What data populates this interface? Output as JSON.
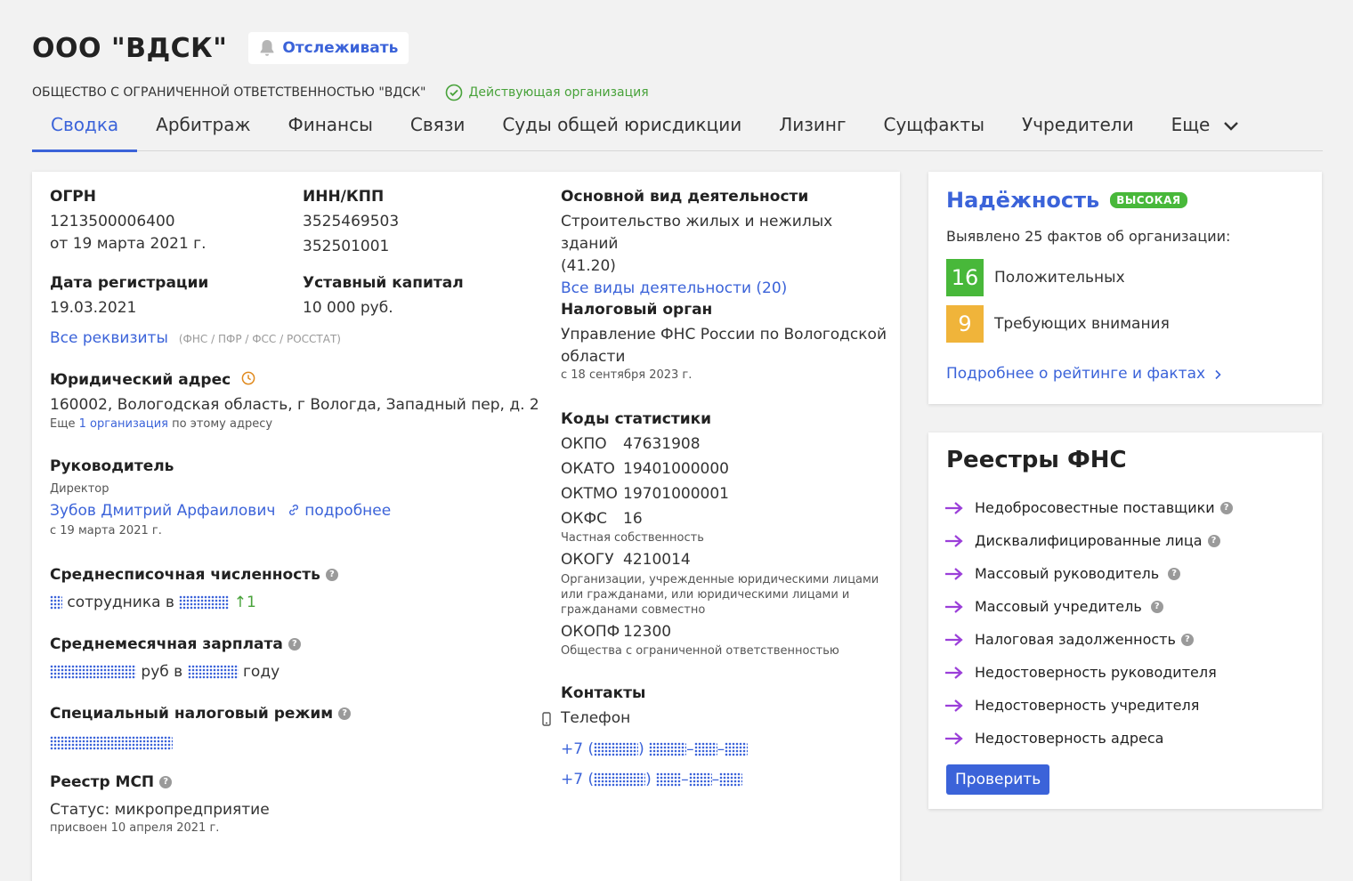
{
  "header": {
    "company_title": "ООО \"ВДСК\"",
    "follow_label": "Отслеживать",
    "full_name": "ОБЩЕСТВО С ОГРАНИЧЕННОЙ ОТВЕТСТВЕННОСТЬЮ \"ВДСК\"",
    "status": "Действующая организация"
  },
  "tabs": [
    "Сводка",
    "Арбитраж",
    "Финансы",
    "Связи",
    "Суды общей юрисдикции",
    "Лизинг",
    "Сущфакты",
    "Учредители",
    "Еще"
  ],
  "requisites": {
    "ogrn_label": "ОГРН",
    "ogrn": "1213500006400",
    "ogrn_date": "от 19 марта 2021 г.",
    "inn_label": "ИНН/КПП",
    "inn": "3525469503",
    "kpp": "352501001",
    "reg_date_label": "Дата регистрации",
    "reg_date": "19.03.2021",
    "capital_label": "Уставный капитал",
    "capital": "10 000 руб.",
    "all_requisites_link": "Все реквизиты",
    "all_requisites_note": "(ФНС / ПФР / ФСС / РОССТАТ)"
  },
  "address": {
    "label": "Юридический адрес",
    "value": "160002, Вологодская область, г Вологда, Западный пер, д. 2",
    "more_prefix": "Еще",
    "more_link": "1 организация",
    "more_suffix": "по этому адресу"
  },
  "director": {
    "label": "Руководитель",
    "role": "Директор",
    "name": "Зубов Дмитрий Арфаилович",
    "details_link": "подробнее",
    "since": "с 19 марта 2021 г."
  },
  "headcount": {
    "label": "Среднесписочная численность",
    "text_mid": "сотрудника в",
    "change": "↑1"
  },
  "salary": {
    "label": "Среднемесячная зарплата",
    "text_mid": "руб в",
    "text_end": "году"
  },
  "tax_regime": {
    "label": "Специальный налоговый режим"
  },
  "msp": {
    "label": "Реестр МСП",
    "status": "Статус: микропредприятие",
    "assigned": "присвоен 10 апреля 2021 г."
  },
  "activity": {
    "label": "Основной вид деятельности",
    "value_line1": "Строительство жилых и нежилых зданий",
    "code": "(41.20)",
    "all_link": "Все виды деятельности (20)"
  },
  "tax_authority": {
    "label": "Налоговый орган",
    "value_line1": "Управление ФНС России по Вологодской",
    "value_line2": "области",
    "since": "с 18 сентября 2023 г."
  },
  "stat_codes": {
    "label": "Коды статистики",
    "okpo_label": "ОКПО",
    "okpo": "47631908",
    "okato_label": "ОКАТО",
    "okato": "19401000000",
    "oktmo_label": "ОКТМО",
    "oktmo": "19701000001",
    "okfs_label": "ОКФС",
    "okfs": "16",
    "okfs_desc": "Частная собственность",
    "okogu_label": "ОКОГУ",
    "okogu": "4210014",
    "okogu_desc_1": "Организации, учрежденные юридическими лицами",
    "okogu_desc_2": "или гражданами, или юридическими лицами и",
    "okogu_desc_3": "гражданами совместно",
    "okopf_label": "ОКОПФ",
    "okopf": "12300",
    "okopf_desc": "Общества с ограниченной ответственностью"
  },
  "contacts": {
    "label": "Контакты",
    "phone_label": "Телефон",
    "phone_prefix": "+7"
  },
  "reliability": {
    "title": "Надёжность",
    "badge": "ВЫСОКАЯ",
    "summary": "Выявлено 25 фактов об организации:",
    "positive_count": "16",
    "positive_label": "Положительных",
    "attention_count": "9",
    "attention_label": "Требующих внимания",
    "more_link": "Подробнее о рейтинге и фактах"
  },
  "fns_registers": {
    "title": "Реестры ФНС",
    "items": [
      {
        "label": "Недобросовестные поставщики",
        "help": true
      },
      {
        "label": "Дисквалифицированные лица",
        "help": true
      },
      {
        "label": "Массовый руководитель",
        "help": true
      },
      {
        "label": "Массовый учредитель",
        "help": true
      },
      {
        "label": "Налоговая задолженность",
        "help": true
      },
      {
        "label": "Недостоверность руководителя",
        "help": false
      },
      {
        "label": "Недостоверность учредителя",
        "help": false
      },
      {
        "label": "Недостоверность адреса",
        "help": false
      }
    ],
    "check_button": "Проверить"
  },
  "colors": {
    "accent": "#3b63d9",
    "success": "#48a23a",
    "positive_box": "#48b83a",
    "warning_box": "#f0b43a",
    "arrow": "#9b3fd9"
  }
}
